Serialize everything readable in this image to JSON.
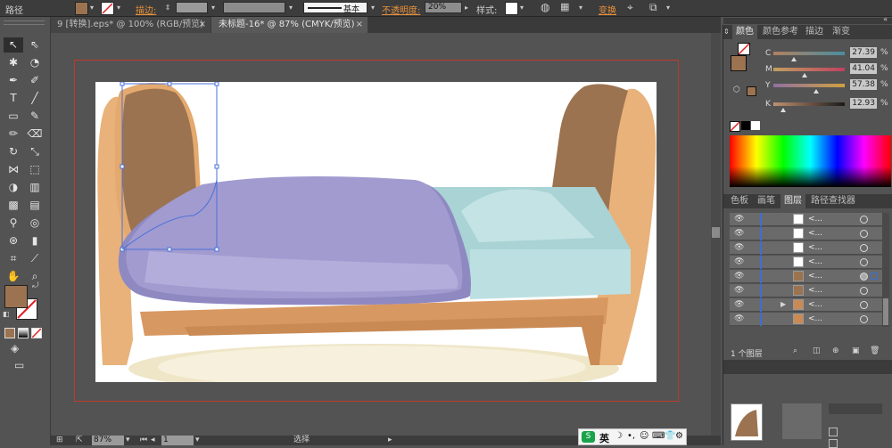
{
  "control_bar": {
    "object_type": "路径",
    "stroke_label": "描边:",
    "stroke_profile": "基本",
    "opacity_label": "不透明度:",
    "opacity_value": "20%",
    "style_label": "样式:",
    "transform_label": "变换"
  },
  "tabs": [
    {
      "label": "9 [转换].eps* @ 100% (RGB/预览)",
      "active": false
    },
    {
      "label": "未标题-16* @ 87% (CMYK/预览)",
      "active": true
    }
  ],
  "color_panel": {
    "tabs": [
      "颜色",
      "颜色参考",
      "描边",
      "渐变"
    ],
    "channels": [
      {
        "label": "C",
        "value": "27.39"
      },
      {
        "label": "M",
        "value": "41.04"
      },
      {
        "label": "Y",
        "value": "57.38"
      },
      {
        "label": "K",
        "value": "12.93"
      }
    ],
    "percent": "%",
    "fill_color": "#9c7350"
  },
  "layers_panel": {
    "tabs": [
      "色板",
      "画笔",
      "图层",
      "路径查找器"
    ],
    "rows": [
      {
        "name": "<..."
      },
      {
        "name": "<..."
      },
      {
        "name": "<..."
      },
      {
        "name": "<..."
      },
      {
        "name": "<..."
      },
      {
        "name": "<..."
      },
      {
        "name": "<..."
      },
      {
        "name": "<..."
      }
    ],
    "footer": "1 个图层"
  },
  "status_bar": {
    "zoom": "87%",
    "page": "1",
    "tool": "选择"
  },
  "ime": {
    "label": "英"
  }
}
